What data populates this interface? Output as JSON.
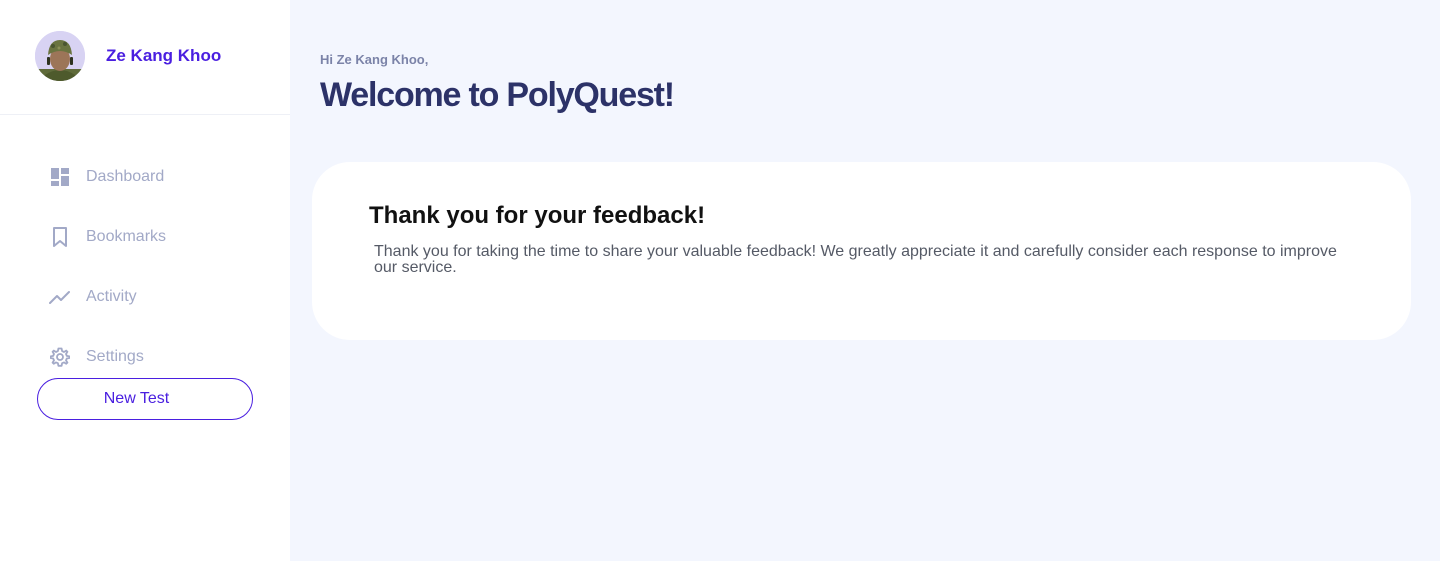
{
  "user": {
    "name": "Ze Kang Khoo"
  },
  "sidebar": {
    "items": [
      {
        "label": "Dashboard",
        "icon": "dashboard-icon"
      },
      {
        "label": "Bookmarks",
        "icon": "bookmark-icon"
      },
      {
        "label": "Activity",
        "icon": "activity-icon"
      },
      {
        "label": "Settings",
        "icon": "gear-icon"
      }
    ],
    "new_test_label": "New Test"
  },
  "header": {
    "greeting": "Hi Ze Kang Khoo,",
    "title": "Welcome to PolyQuest!"
  },
  "card": {
    "title": "Thank you for your feedback!",
    "text": "Thank you for taking the time to share your valuable feedback! We greatly appreciate it and carefully consider each response to improve our service."
  },
  "colors": {
    "accent": "#4a1fe0",
    "nav_text": "#a2a9c7",
    "heading": "#2c3268",
    "background": "#f3f6fe"
  }
}
